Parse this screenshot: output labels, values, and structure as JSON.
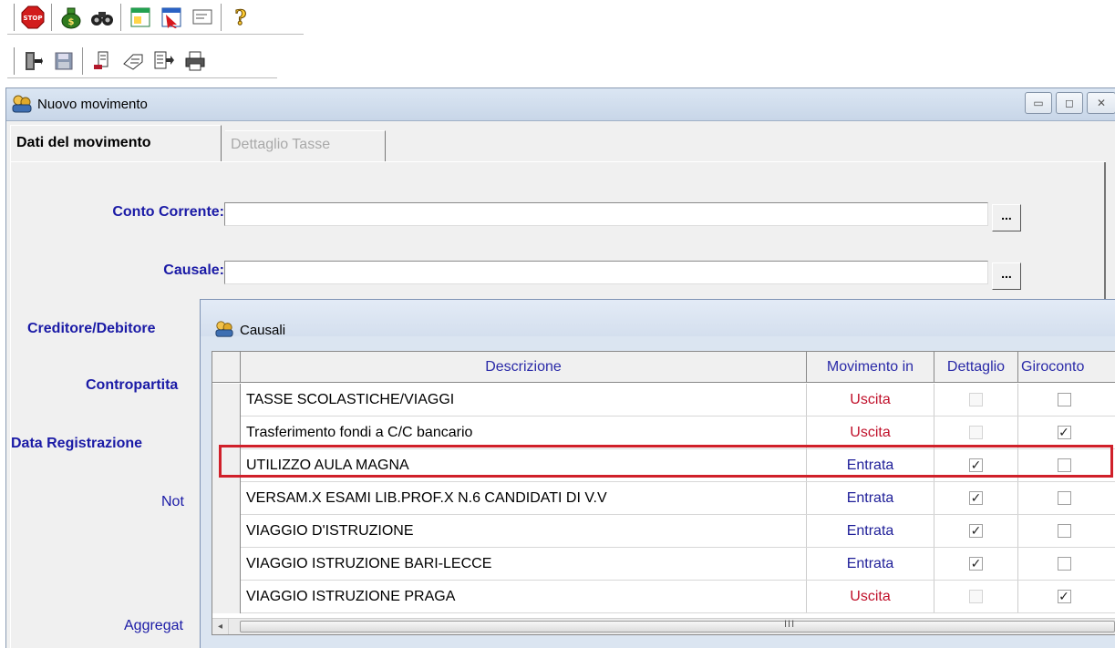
{
  "main_window": {
    "title": "Nuovo movimento",
    "tabs": [
      {
        "label": "Dati del movimento",
        "active": true
      },
      {
        "label": "Dettaglio Tasse",
        "active": false
      }
    ],
    "fields": {
      "conto_corrente": {
        "label": "Conto Corrente:",
        "value": ""
      },
      "causale": {
        "label": "Causale:",
        "value": ""
      },
      "creditore_debitore": {
        "label": "Creditore/Debitore"
      },
      "contropartita": {
        "label": "Contropartita"
      },
      "data_registrazione": {
        "label": "Data Registrazione"
      },
      "note": {
        "label": "Not"
      },
      "aggregato": {
        "label": "Aggregat"
      }
    },
    "browse_button_label": "..."
  },
  "popup": {
    "title": "Causali",
    "columns": [
      "Descrizione",
      "Movimento in",
      "Dettaglio",
      "Giroconto"
    ],
    "rows": [
      {
        "descrizione": "TASSE SCOLASTICHE/VIAGGI",
        "movimento": "Uscita",
        "dettaglio": false,
        "giroconto": false,
        "dettaglio_disabled": true
      },
      {
        "descrizione": "Trasferimento fondi a C/C bancario",
        "movimento": "Uscita",
        "dettaglio": false,
        "giroconto": true,
        "dettaglio_disabled": true,
        "highlighted": true
      },
      {
        "descrizione": "UTILIZZO AULA MAGNA",
        "movimento": "Entrata",
        "dettaglio": true,
        "giroconto": false
      },
      {
        "descrizione": "VERSAM.X ESAMI LIB.PROF.X N.6 CANDIDATI DI V.V",
        "movimento": "Entrata",
        "dettaglio": true,
        "giroconto": false
      },
      {
        "descrizione": "VIAGGIO D'ISTRUZIONE",
        "movimento": "Entrata",
        "dettaglio": true,
        "giroconto": false
      },
      {
        "descrizione": "VIAGGIO ISTRUZIONE BARI-LECCE",
        "movimento": "Entrata",
        "dettaglio": true,
        "giroconto": false
      },
      {
        "descrizione": "VIAGGIO ISTRUZIONE PRAGA",
        "movimento": "Uscita",
        "dettaglio": false,
        "giroconto": true,
        "dettaglio_disabled": true
      }
    ],
    "scroll_grip": "III"
  },
  "colors": {
    "label_blue": "#1a1aa6",
    "uscita_red": "#c0102a",
    "entrata_blue": "#1e1e98",
    "highlight_red": "#d0202a"
  },
  "toolbar_icons": {
    "row1": [
      "stop-icon",
      "money-bag-icon",
      "binoculars-icon",
      "green-window-icon",
      "red-arrow-window-icon",
      "envelope-window-icon",
      "help-question-icon"
    ],
    "row2": [
      "exit-door-icon",
      "save-disk-icon",
      "edit-form-icon",
      "eraser-icon",
      "export-icon",
      "printer-icon"
    ]
  }
}
